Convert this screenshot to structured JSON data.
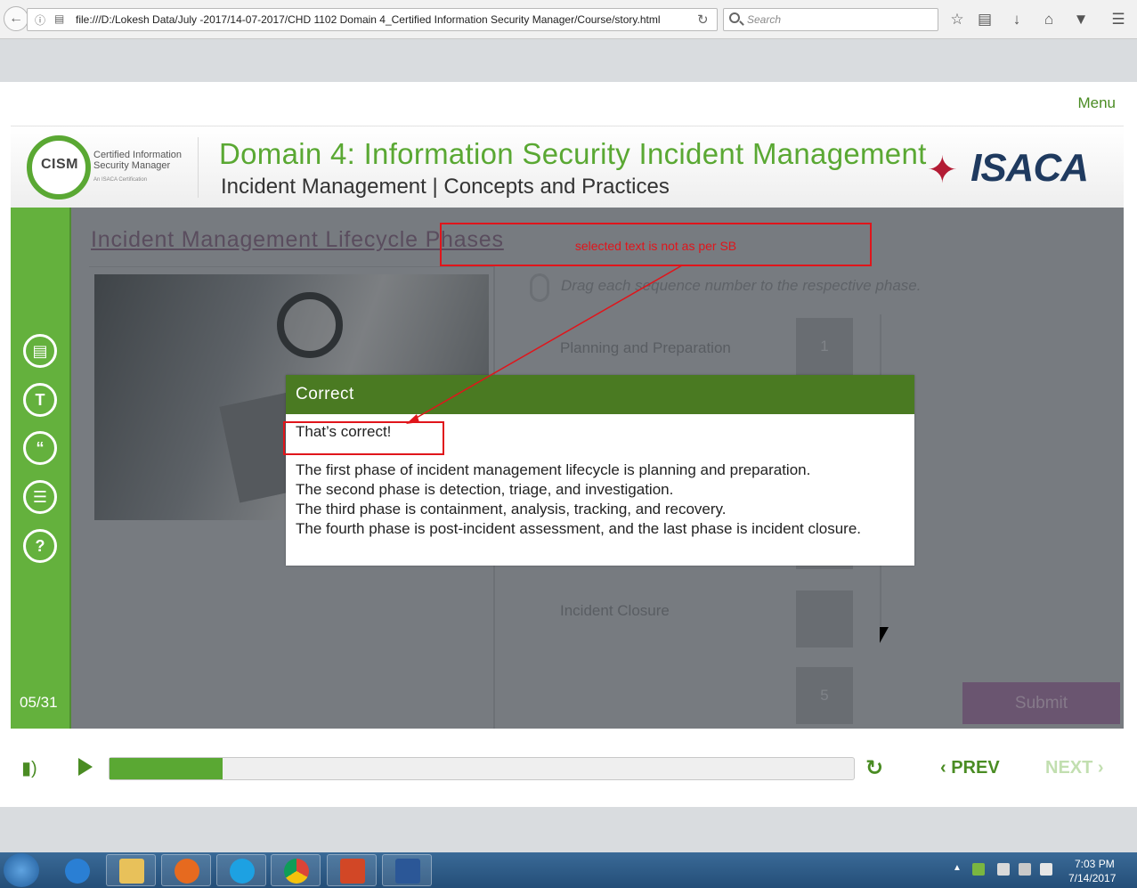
{
  "browser": {
    "url": "file:///D:/Lokesh Data/July -2017/14-07-2017/CHD 1102 Domain 4_Certified Information Security Manager/Course/story.html",
    "search_placeholder": "Search"
  },
  "player": {
    "menu_label": "Menu",
    "logo": {
      "cism": "CISM",
      "line1": "Certified Information",
      "line2": "Security Manager",
      "line3": "An ISACA Certification",
      "isaca": "ISACA"
    },
    "domain_title": "Domain 4: Information Security Incident Management",
    "domain_subtitle": "Incident Management | Concepts and Practices",
    "page_counter": "05/31"
  },
  "slide": {
    "title": "Incident Management Lifecycle Phases",
    "instruction": "Drag each sequence number to the respective phase.",
    "phases": [
      {
        "label": "Planning and Preparation",
        "number": "1"
      },
      {
        "label": "Incident Closure",
        "number": "5"
      }
    ],
    "submit_label": "Submit"
  },
  "feedback": {
    "header": "Correct",
    "correct_text": "That’s correct!",
    "lines": [
      "The first phase of incident management lifecycle is planning and preparation.",
      "The second phase is detection, triage, and investigation.",
      "The third phase is containment, analysis, tracking, and recovery.",
      "The fourth phase is post-incident assessment, and the last phase is incident closure."
    ]
  },
  "annotation": {
    "text": "selected text is not as per SB",
    "color": "#e0151b"
  },
  "footer": {
    "progress_fraction": 0.152,
    "prev_label": "PREV",
    "next_label": "NEXT",
    "accent_color": "#4a8c23"
  },
  "taskbar": {
    "time": "7:03 PM",
    "date": "7/14/2017"
  }
}
